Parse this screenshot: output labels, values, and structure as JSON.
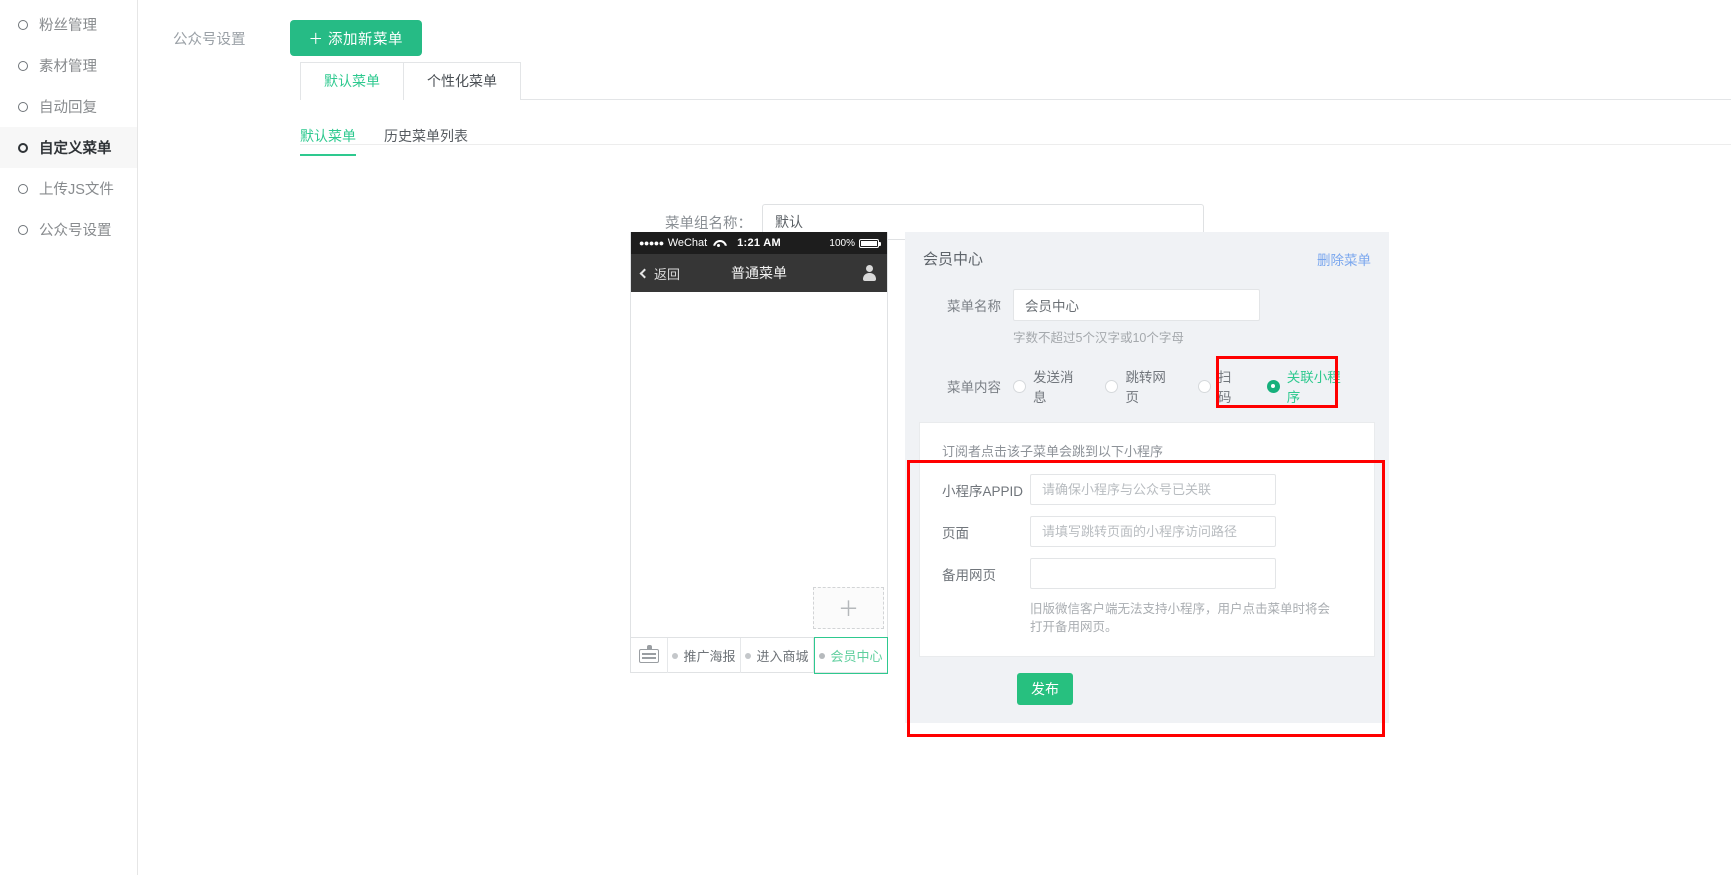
{
  "sidebar": {
    "items": [
      {
        "label": "粉丝管理",
        "active": false
      },
      {
        "label": "素材管理",
        "active": false
      },
      {
        "label": "自动回复",
        "active": false
      },
      {
        "label": "自定义菜单",
        "active": true
      },
      {
        "label": "上传JS文件",
        "active": false
      },
      {
        "label": "公众号设置",
        "active": false
      }
    ]
  },
  "topbar": {
    "label": "公众号设置",
    "add_button": "＋ 添加新菜单"
  },
  "tabs": [
    {
      "label": "默认菜单",
      "active": true
    },
    {
      "label": "个性化菜单",
      "active": false
    }
  ],
  "subtabs": [
    {
      "label": "默认菜单",
      "active": true
    },
    {
      "label": "历史菜单列表",
      "active": false
    }
  ],
  "group": {
    "label": "菜单组名称：",
    "value": "默认",
    "placeholder": "默认"
  },
  "phone": {
    "carrier": "WeChat",
    "dots": "●●●●●",
    "time": "1:21 AM",
    "battery_text": "100%",
    "back_label": "返回",
    "nav_title": "普通菜单",
    "add_placeholder": "＋",
    "menu_items": [
      {
        "label": "推广海报",
        "selected": false
      },
      {
        "label": "进入商城",
        "selected": false
      },
      {
        "label": "会员中心",
        "selected": true
      }
    ]
  },
  "config": {
    "title": "会员中心",
    "delete_label": "删除菜单",
    "name_label": "菜单名称",
    "name_value": "会员中心",
    "name_hint": "字数不超过5个汉字或10个字母",
    "content_label": "菜单内容",
    "content_options": [
      {
        "label": "发送消息",
        "checked": false
      },
      {
        "label": "跳转网页",
        "checked": false
      },
      {
        "label": "扫码",
        "checked": false
      },
      {
        "label": "关联小程序",
        "checked": true
      }
    ],
    "mini": {
      "lead": "订阅者点击该子菜单会跳到以下小程序",
      "appid_label": "小程序APPID",
      "appid_placeholder": "请确保小程序与公众号已关联",
      "appid_value": "",
      "page_label": "页面",
      "page_placeholder": "请填写跳转页面的小程序访问路径",
      "page_value": "",
      "fallback_label": "备用网页",
      "fallback_placeholder": "",
      "fallback_value": "",
      "fallback_note": "旧版微信客户端无法支持小程序，用户点击菜单时将会打开备用网页。"
    },
    "publish_label": "发布"
  },
  "colors": {
    "brand_green": "#2ec98f",
    "button_green": "#26bb85",
    "highlight_red": "#ff0000",
    "link_blue": "#7aa7ee"
  }
}
